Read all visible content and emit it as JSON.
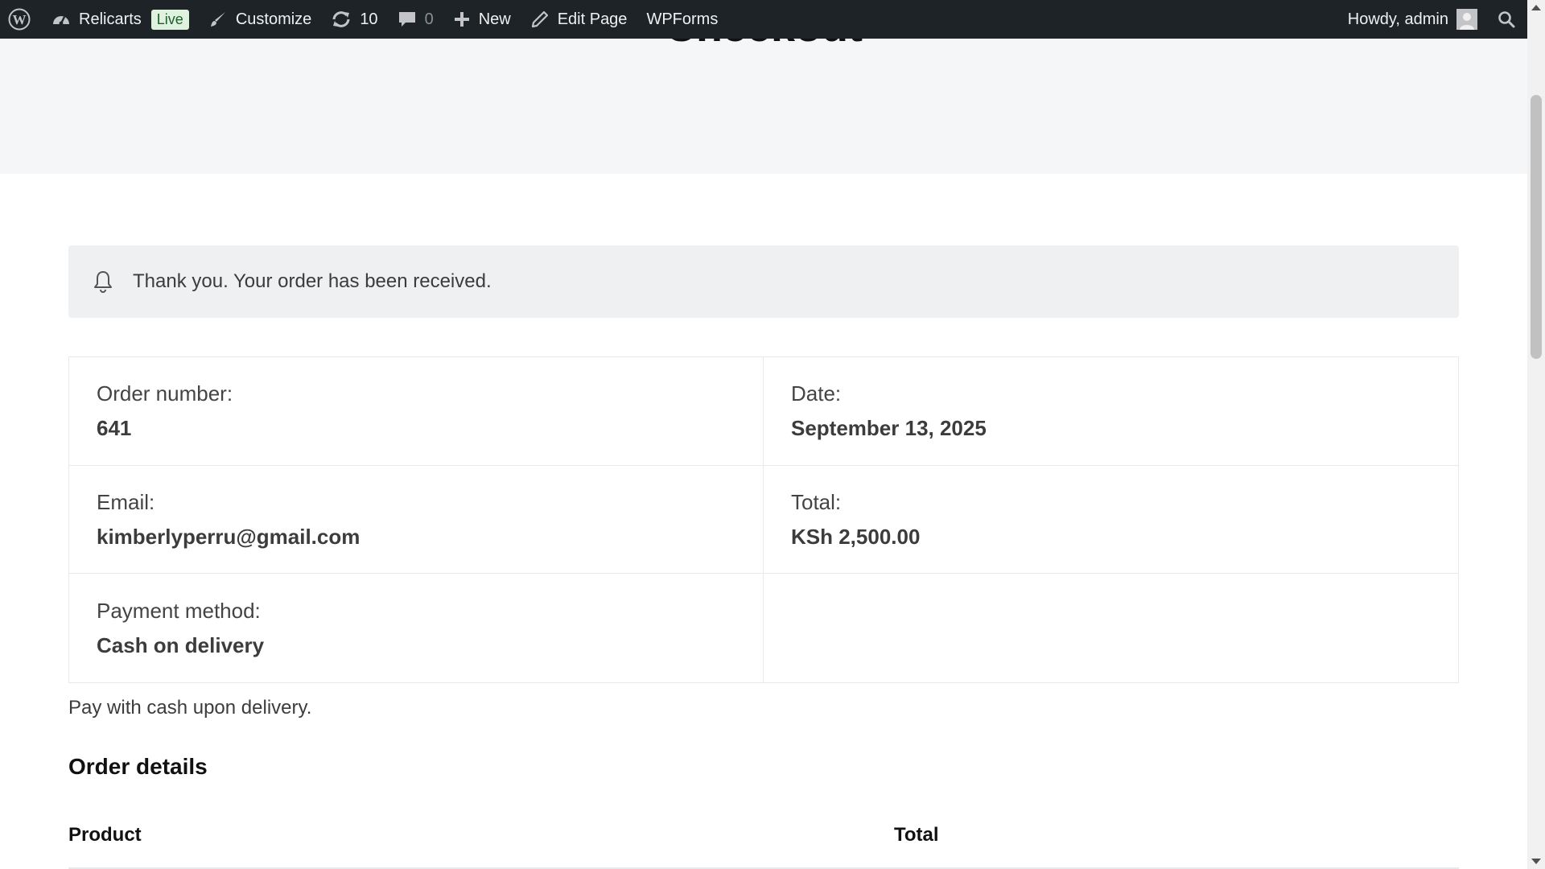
{
  "adminbar": {
    "site_name": "Relicarts",
    "live_badge": "Live",
    "customize": "Customize",
    "updates_count": "10",
    "comments_count": "0",
    "new_label": "New",
    "edit_page": "Edit Page",
    "wpforms": "WPForms",
    "howdy": "Howdy, admin",
    "icons": [
      "wordpress-logo-icon",
      "dashboard-icon",
      "brush-icon",
      "refresh-icon",
      "comment-icon",
      "plus-icon",
      "pencil-icon",
      "avatar",
      "search-icon"
    ]
  },
  "page": {
    "title": "Checkout"
  },
  "notice": {
    "message": "Thank you. Your order has been received.",
    "icon": "bell-icon"
  },
  "overview": {
    "order_number_label": "Order number:",
    "order_number": "641",
    "date_label": "Date:",
    "date": "September 13, 2025",
    "email_label": "Email:",
    "email": "kimberlyperru@gmail.com",
    "total_label": "Total:",
    "total": "KSh 2,500.00",
    "payment_label": "Payment method:",
    "payment": "Cash on delivery"
  },
  "payment_note": "Pay with cash upon delivery.",
  "order_details": {
    "title": "Order details",
    "columns": [
      "Product",
      "Total"
    ]
  },
  "colors": {
    "adminbar_bg": "#1d2327",
    "live_badge_bg": "#dff2e0",
    "title_band_bg": "#f5f6f7",
    "notice_bg": "#eff0f1"
  }
}
